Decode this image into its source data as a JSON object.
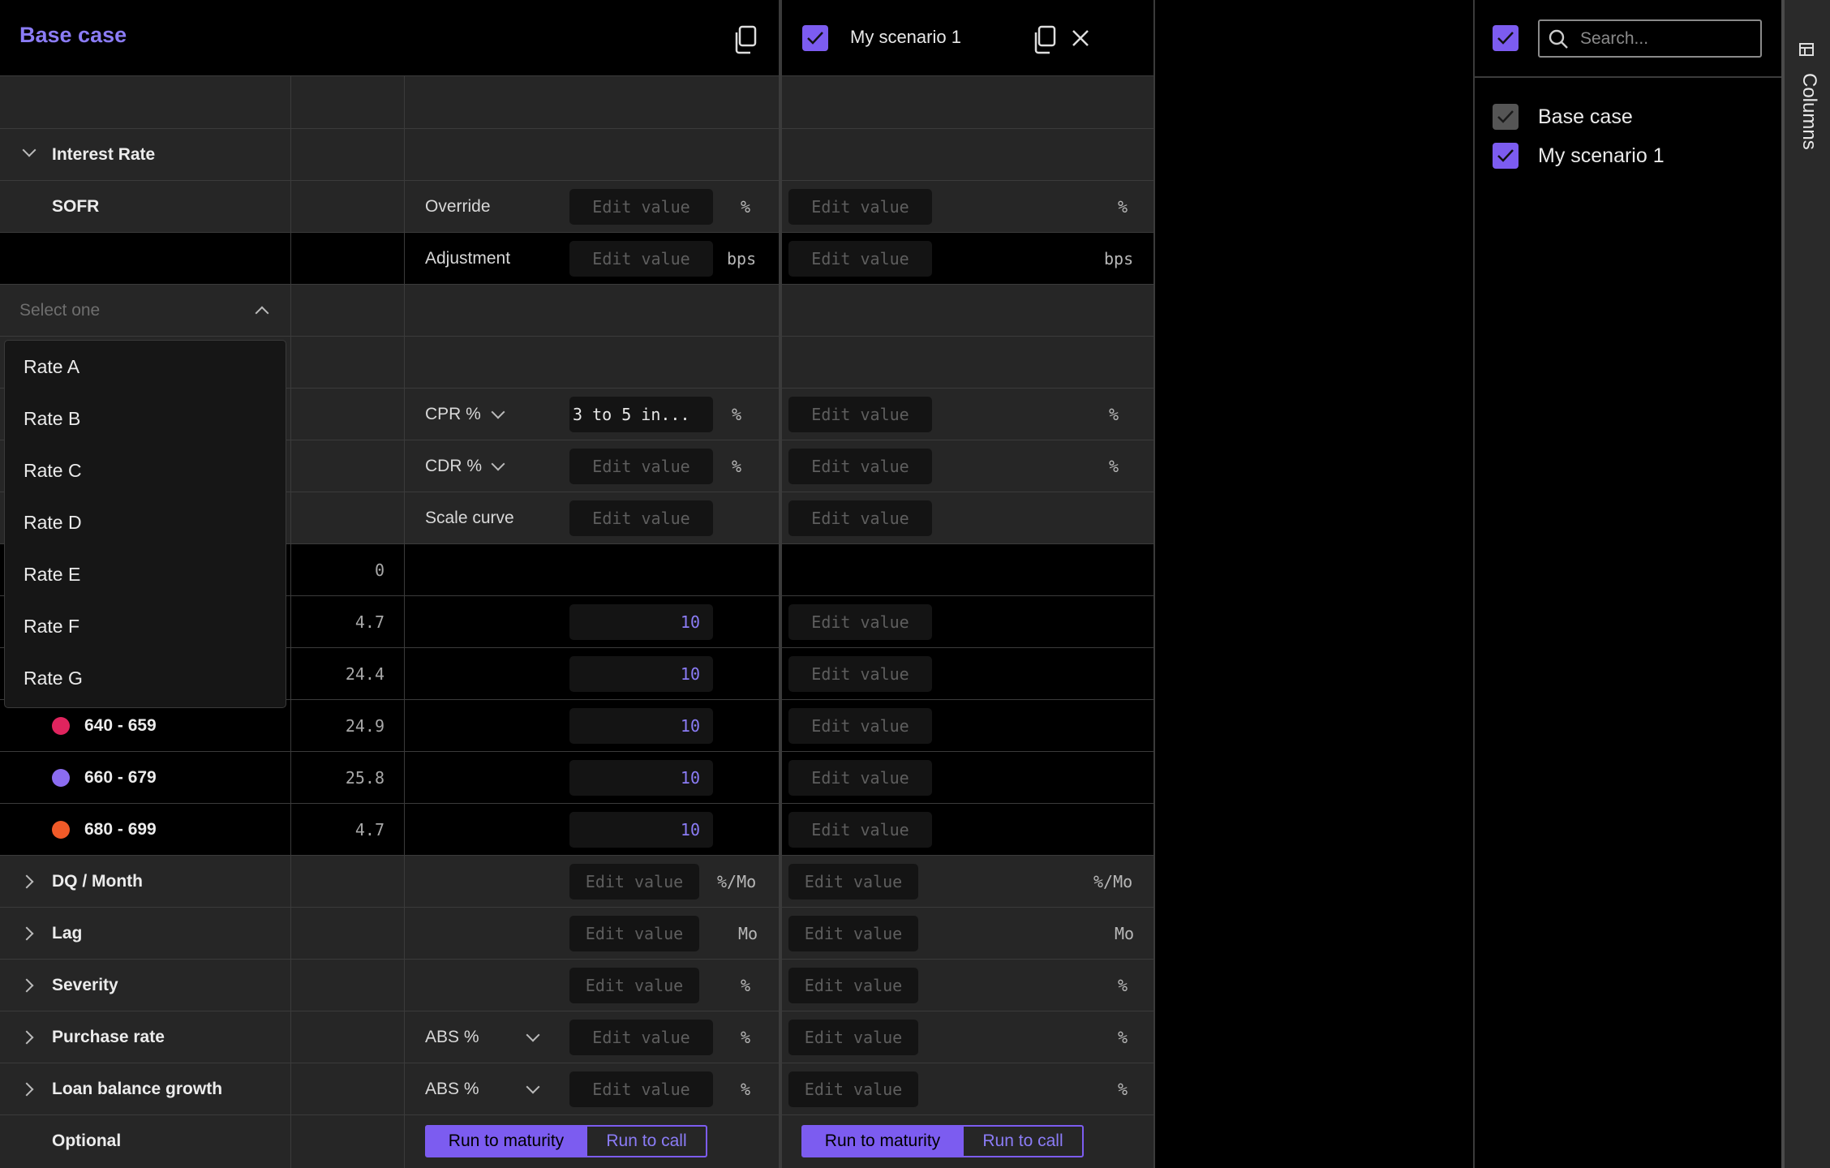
{
  "header": {
    "base_title": "Base case",
    "scenario_title": "My scenario 1",
    "search_placeholder": "Search..."
  },
  "columns_panel": {
    "tab_label": "Columns",
    "items": [
      {
        "label": "Base case",
        "checked": true,
        "disabled": true
      },
      {
        "label": "My scenario 1",
        "checked": true,
        "disabled": false
      }
    ]
  },
  "edit_placeholder": "Edit value",
  "interest_rate": {
    "section_label": "Interest Rate",
    "sofr_label": "SOFR",
    "override_label": "Override",
    "adjustment_label": "Adjustment",
    "unit_pct": "%",
    "unit_bps": "bps"
  },
  "select": {
    "placeholder": "Select one",
    "options": [
      "Rate A",
      "Rate B",
      "Rate C",
      "Rate D",
      "Rate E",
      "Rate F",
      "Rate G"
    ]
  },
  "prepay": {
    "cpr_label": "CPR %",
    "cpr_value": "3 to 5 in...",
    "cdr_label": "CDR %",
    "scale_label": "Scale curve"
  },
  "fico_rows": [
    {
      "label": "",
      "value": "0",
      "input": ""
    },
    {
      "label": "",
      "value": "4.7",
      "input": "10"
    },
    {
      "label": "",
      "value": "24.4",
      "input": "10"
    },
    {
      "label": "640 - 659",
      "value": "24.9",
      "input": "10",
      "color": "#e0245e"
    },
    {
      "label": "660 - 679",
      "value": "25.8",
      "input": "10",
      "color": "#8b6cf0"
    },
    {
      "label": "680 - 699",
      "value": "4.7",
      "input": "10",
      "color": "#f05a28"
    }
  ],
  "sections": [
    {
      "label": "DQ / Month",
      "unit": "%/Mo"
    },
    {
      "label": "Lag",
      "unit": "Mo"
    },
    {
      "label": "Severity",
      "unit": "%"
    },
    {
      "label": "Purchase rate",
      "unit": "%",
      "select": "ABS %"
    },
    {
      "label": "Loan balance growth",
      "unit": "%",
      "select": "ABS %"
    }
  ],
  "optional": {
    "label": "Optional",
    "run_maturity": "Run to maturity",
    "run_call": "Run to call"
  },
  "colors": {
    "accent": "#7c5cf0",
    "row_gray": "#262626",
    "background": "#000000"
  }
}
